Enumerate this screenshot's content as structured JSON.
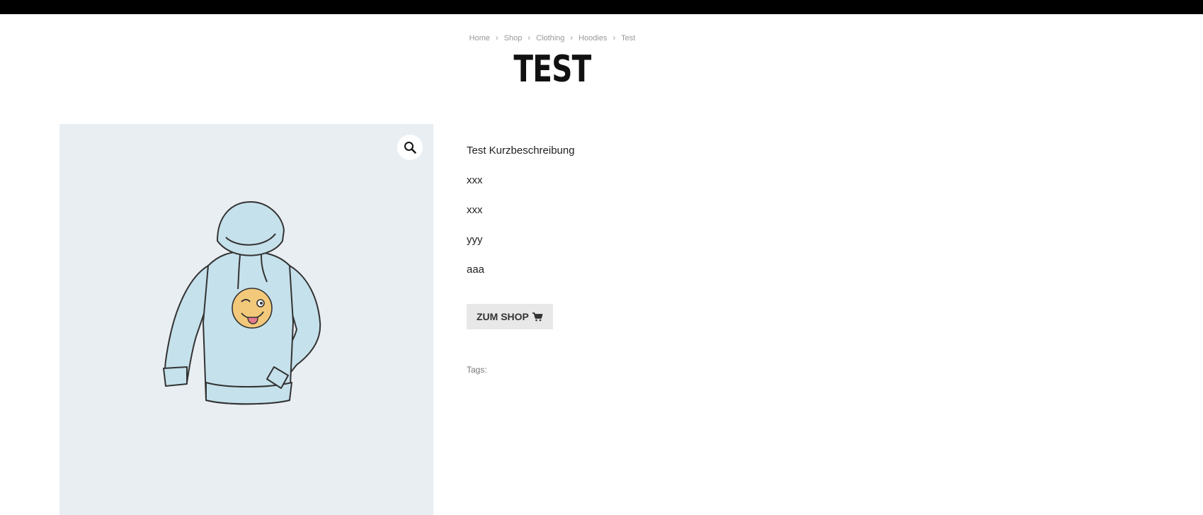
{
  "breadcrumb": {
    "items": [
      "Home",
      "Shop",
      "Clothing",
      "Hoodies",
      "Test"
    ],
    "separator": "›"
  },
  "product": {
    "title": "TEST",
    "description_lines": [
      "Test Kurzbeschreibung",
      "xxx",
      "xxx",
      "yyy",
      "aaa"
    ],
    "shop_button_label": "ZUM SHOP",
    "tags_label": "Tags:"
  },
  "icons": {
    "zoom": "magnifier-icon",
    "cart": "cart-icon"
  },
  "colors": {
    "top_bar": "#000000",
    "gallery_bg": "#e9eef2",
    "hoodie": "#c5e1ec",
    "button_bg": "#e8e8e8"
  }
}
